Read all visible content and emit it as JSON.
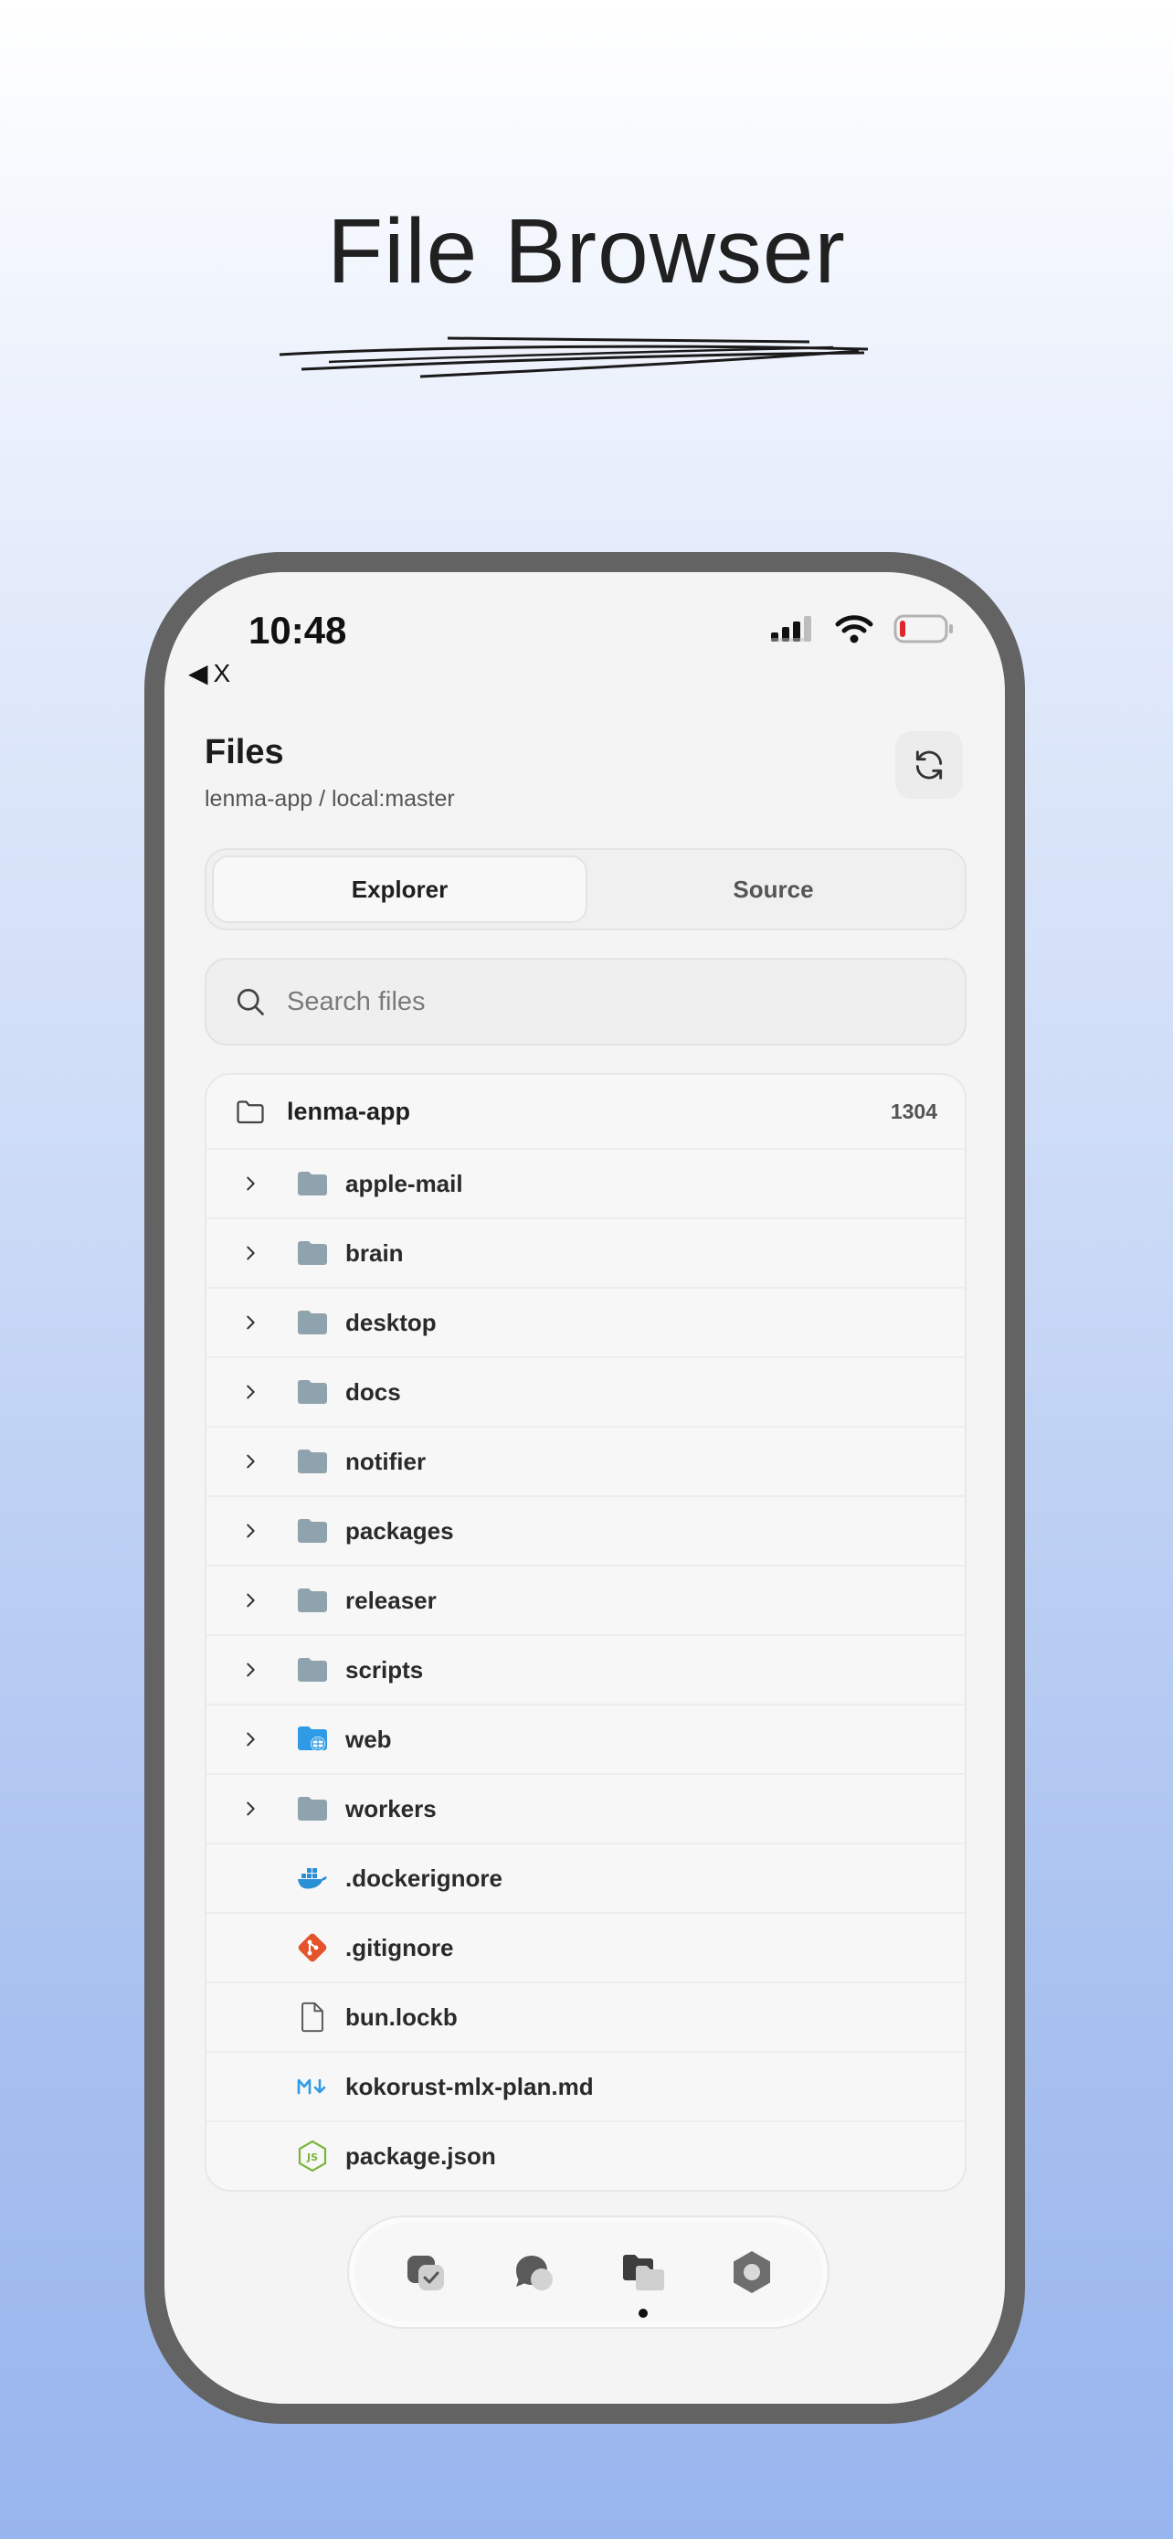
{
  "promo": {
    "title": "File Browser"
  },
  "status_bar": {
    "time": "10:48",
    "back_label": "X"
  },
  "header": {
    "title": "Files",
    "subtitle": "lenma-app / local:master"
  },
  "tabs": [
    {
      "label": "Explorer",
      "active": true
    },
    {
      "label": "Source",
      "active": false
    }
  ],
  "search": {
    "placeholder": "Search files",
    "value": ""
  },
  "tree": {
    "root": {
      "name": "lenma-app",
      "count": "1304"
    },
    "folders": [
      {
        "name": "apple-mail",
        "icon": "folder-icon"
      },
      {
        "name": "brain",
        "icon": "folder-icon"
      },
      {
        "name": "desktop",
        "icon": "folder-icon"
      },
      {
        "name": "docs",
        "icon": "folder-icon"
      },
      {
        "name": "notifier",
        "icon": "folder-icon"
      },
      {
        "name": "packages",
        "icon": "folder-icon"
      },
      {
        "name": "releaser",
        "icon": "folder-icon"
      },
      {
        "name": "scripts",
        "icon": "folder-icon"
      },
      {
        "name": "web",
        "icon": "web-folder-icon"
      },
      {
        "name": "workers",
        "icon": "folder-icon"
      }
    ],
    "files": [
      {
        "name": ".dockerignore",
        "icon": "docker-icon"
      },
      {
        "name": ".gitignore",
        "icon": "git-icon"
      },
      {
        "name": "bun.lockb",
        "icon": "file-icon"
      },
      {
        "name": "kokorust-mlx-plan.md",
        "icon": "markdown-icon"
      },
      {
        "name": "package.json",
        "icon": "nodejs-icon"
      }
    ]
  },
  "dock": [
    {
      "icon": "tasks-icon"
    },
    {
      "icon": "chat-icon"
    },
    {
      "icon": "files-icon",
      "active": true
    },
    {
      "icon": "settings-icon"
    }
  ],
  "colors": {
    "folder": "#8fa3ae",
    "web_folder": "#2f9be6",
    "docker": "#2b8fd6",
    "git": "#e5532d",
    "markdown": "#2f9be6",
    "node": "#7cb53a",
    "battery_low": "#e0262a"
  }
}
